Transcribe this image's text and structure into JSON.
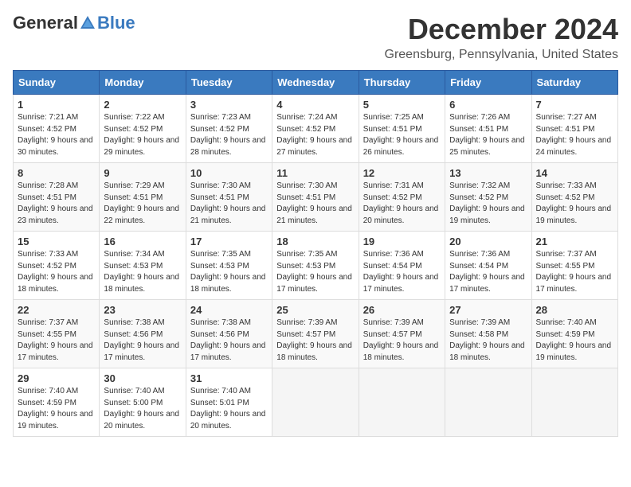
{
  "header": {
    "logo_general": "General",
    "logo_blue": "Blue",
    "month_title": "December 2024",
    "location": "Greensburg, Pennsylvania, United States"
  },
  "weekdays": [
    "Sunday",
    "Monday",
    "Tuesday",
    "Wednesday",
    "Thursday",
    "Friday",
    "Saturday"
  ],
  "weeks": [
    [
      {
        "day": "1",
        "sunrise": "7:21 AM",
        "sunset": "4:52 PM",
        "daylight": "9 hours and 30 minutes."
      },
      {
        "day": "2",
        "sunrise": "7:22 AM",
        "sunset": "4:52 PM",
        "daylight": "9 hours and 29 minutes."
      },
      {
        "day": "3",
        "sunrise": "7:23 AM",
        "sunset": "4:52 PM",
        "daylight": "9 hours and 28 minutes."
      },
      {
        "day": "4",
        "sunrise": "7:24 AM",
        "sunset": "4:52 PM",
        "daylight": "9 hours and 27 minutes."
      },
      {
        "day": "5",
        "sunrise": "7:25 AM",
        "sunset": "4:51 PM",
        "daylight": "9 hours and 26 minutes."
      },
      {
        "day": "6",
        "sunrise": "7:26 AM",
        "sunset": "4:51 PM",
        "daylight": "9 hours and 25 minutes."
      },
      {
        "day": "7",
        "sunrise": "7:27 AM",
        "sunset": "4:51 PM",
        "daylight": "9 hours and 24 minutes."
      }
    ],
    [
      {
        "day": "8",
        "sunrise": "7:28 AM",
        "sunset": "4:51 PM",
        "daylight": "9 hours and 23 minutes."
      },
      {
        "day": "9",
        "sunrise": "7:29 AM",
        "sunset": "4:51 PM",
        "daylight": "9 hours and 22 minutes."
      },
      {
        "day": "10",
        "sunrise": "7:30 AM",
        "sunset": "4:51 PM",
        "daylight": "9 hours and 21 minutes."
      },
      {
        "day": "11",
        "sunrise": "7:30 AM",
        "sunset": "4:51 PM",
        "daylight": "9 hours and 21 minutes."
      },
      {
        "day": "12",
        "sunrise": "7:31 AM",
        "sunset": "4:52 PM",
        "daylight": "9 hours and 20 minutes."
      },
      {
        "day": "13",
        "sunrise": "7:32 AM",
        "sunset": "4:52 PM",
        "daylight": "9 hours and 19 minutes."
      },
      {
        "day": "14",
        "sunrise": "7:33 AM",
        "sunset": "4:52 PM",
        "daylight": "9 hours and 19 minutes."
      }
    ],
    [
      {
        "day": "15",
        "sunrise": "7:33 AM",
        "sunset": "4:52 PM",
        "daylight": "9 hours and 18 minutes."
      },
      {
        "day": "16",
        "sunrise": "7:34 AM",
        "sunset": "4:53 PM",
        "daylight": "9 hours and 18 minutes."
      },
      {
        "day": "17",
        "sunrise": "7:35 AM",
        "sunset": "4:53 PM",
        "daylight": "9 hours and 18 minutes."
      },
      {
        "day": "18",
        "sunrise": "7:35 AM",
        "sunset": "4:53 PM",
        "daylight": "9 hours and 17 minutes."
      },
      {
        "day": "19",
        "sunrise": "7:36 AM",
        "sunset": "4:54 PM",
        "daylight": "9 hours and 17 minutes."
      },
      {
        "day": "20",
        "sunrise": "7:36 AM",
        "sunset": "4:54 PM",
        "daylight": "9 hours and 17 minutes."
      },
      {
        "day": "21",
        "sunrise": "7:37 AM",
        "sunset": "4:55 PM",
        "daylight": "9 hours and 17 minutes."
      }
    ],
    [
      {
        "day": "22",
        "sunrise": "7:37 AM",
        "sunset": "4:55 PM",
        "daylight": "9 hours and 17 minutes."
      },
      {
        "day": "23",
        "sunrise": "7:38 AM",
        "sunset": "4:56 PM",
        "daylight": "9 hours and 17 minutes."
      },
      {
        "day": "24",
        "sunrise": "7:38 AM",
        "sunset": "4:56 PM",
        "daylight": "9 hours and 17 minutes."
      },
      {
        "day": "25",
        "sunrise": "7:39 AM",
        "sunset": "4:57 PM",
        "daylight": "9 hours and 18 minutes."
      },
      {
        "day": "26",
        "sunrise": "7:39 AM",
        "sunset": "4:57 PM",
        "daylight": "9 hours and 18 minutes."
      },
      {
        "day": "27",
        "sunrise": "7:39 AM",
        "sunset": "4:58 PM",
        "daylight": "9 hours and 18 minutes."
      },
      {
        "day": "28",
        "sunrise": "7:40 AM",
        "sunset": "4:59 PM",
        "daylight": "9 hours and 19 minutes."
      }
    ],
    [
      {
        "day": "29",
        "sunrise": "7:40 AM",
        "sunset": "4:59 PM",
        "daylight": "9 hours and 19 minutes."
      },
      {
        "day": "30",
        "sunrise": "7:40 AM",
        "sunset": "5:00 PM",
        "daylight": "9 hours and 20 minutes."
      },
      {
        "day": "31",
        "sunrise": "7:40 AM",
        "sunset": "5:01 PM",
        "daylight": "9 hours and 20 minutes."
      },
      null,
      null,
      null,
      null
    ]
  ]
}
